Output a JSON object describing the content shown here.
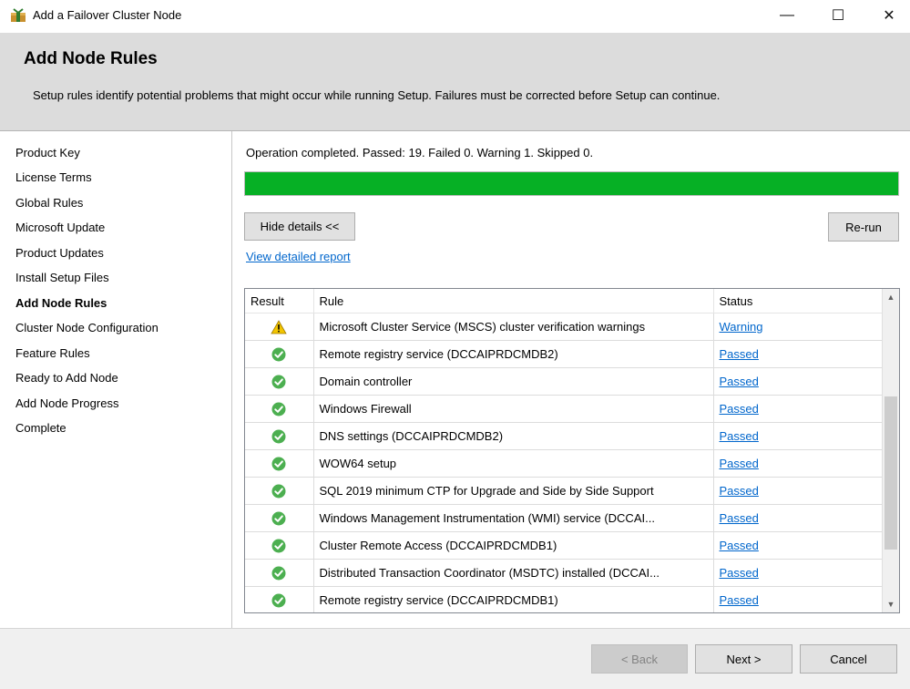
{
  "window": {
    "title": "Add a Failover Cluster Node",
    "minimize_glyph": "—",
    "maximize_glyph": "☐",
    "close_glyph": "✕"
  },
  "header": {
    "title": "Add Node Rules",
    "description": "Setup rules identify potential problems that might occur while running Setup. Failures must be corrected before Setup can continue."
  },
  "sidebar": {
    "items": [
      {
        "label": "Product Key"
      },
      {
        "label": "License Terms"
      },
      {
        "label": "Global Rules"
      },
      {
        "label": "Microsoft Update"
      },
      {
        "label": "Product Updates"
      },
      {
        "label": "Install Setup Files"
      },
      {
        "label": "Add Node Rules"
      },
      {
        "label": "Cluster Node Configuration"
      },
      {
        "label": "Feature Rules"
      },
      {
        "label": "Ready to Add Node"
      },
      {
        "label": "Add Node Progress"
      },
      {
        "label": "Complete"
      }
    ],
    "active_index": 6
  },
  "main": {
    "operation_text": "Operation completed. Passed: 19.   Failed 0.   Warning 1.   Skipped 0.",
    "progress_percent": 100,
    "hide_details_label": "Hide details <<",
    "rerun_label": "Re-run",
    "report_link": "View detailed report",
    "table": {
      "columns": {
        "result": "Result",
        "rule": "Rule",
        "status": "Status"
      },
      "rows": [
        {
          "icon": "warning",
          "rule": "Microsoft Cluster Service (MSCS) cluster verification warnings",
          "status": "Warning"
        },
        {
          "icon": "passed",
          "rule": "Remote registry service (DCCAIPRDCMDB2)",
          "status": "Passed"
        },
        {
          "icon": "passed",
          "rule": "Domain controller",
          "status": "Passed"
        },
        {
          "icon": "passed",
          "rule": "Windows Firewall",
          "status": "Passed"
        },
        {
          "icon": "passed",
          "rule": "DNS settings (DCCAIPRDCMDB2)",
          "status": "Passed"
        },
        {
          "icon": "passed",
          "rule": "WOW64 setup",
          "status": "Passed"
        },
        {
          "icon": "passed",
          "rule": "SQL 2019 minimum CTP for Upgrade and Side by Side Support",
          "status": "Passed"
        },
        {
          "icon": "passed",
          "rule": "Windows Management Instrumentation (WMI) service (DCCAI...",
          "status": "Passed"
        },
        {
          "icon": "passed",
          "rule": "Cluster Remote Access (DCCAIPRDCMDB1)",
          "status": "Passed"
        },
        {
          "icon": "passed",
          "rule": "Distributed Transaction Coordinator (MSDTC) installed (DCCAI...",
          "status": "Passed"
        },
        {
          "icon": "passed",
          "rule": "Remote registry service (DCCAIPRDCMDB1)",
          "status": "Passed"
        }
      ]
    }
  },
  "footer": {
    "back_label": "< Back",
    "next_label": "Next >",
    "cancel_label": "Cancel"
  },
  "colors": {
    "progress_fill": "#06b025",
    "link": "#0066cc",
    "header_bg": "#dcdcdc",
    "passed_icon": "#4caf50",
    "warning_icon": "#f2c500"
  }
}
